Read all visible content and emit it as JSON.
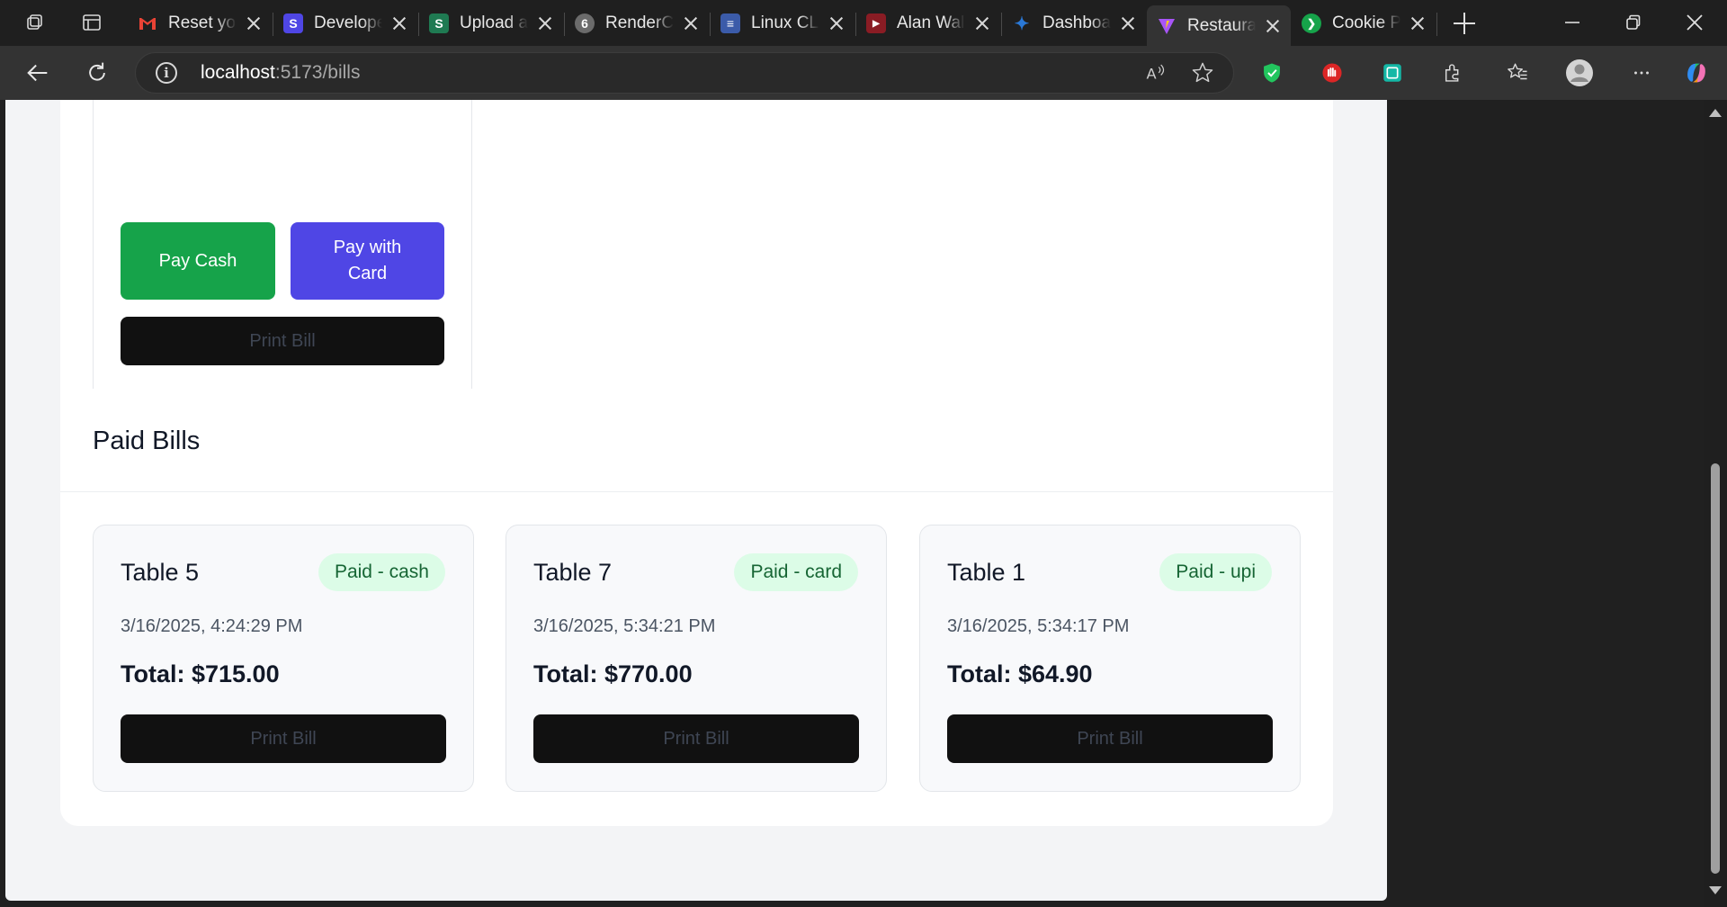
{
  "browser": {
    "tabs": [
      {
        "title": "Reset your password",
        "favicon": "gmail-icon",
        "color": "#ea4335"
      },
      {
        "title": "Developer",
        "favicon": "s-icon",
        "color": "#4f46e5"
      },
      {
        "title": "Upload and",
        "favicon": "s-icon",
        "color": "#1f7a52"
      },
      {
        "title": "RenderCV",
        "favicon": "render-icon",
        "color": "#6b6b6b"
      },
      {
        "title": "Linux CLI",
        "favicon": "doc-icon",
        "color": "#3b5ba9"
      },
      {
        "title": "Alan Walker",
        "favicon": "youtube-icon",
        "color": "#c4302b"
      },
      {
        "title": "Dashboard",
        "favicon": "dashboard-icon",
        "color": "#2a78d6"
      },
      {
        "title": "Restaurant",
        "favicon": "vite-icon",
        "color": "#a855f7",
        "active": true
      },
      {
        "title": "Cookie Pol",
        "favicon": "cookie-icon",
        "color": "#16a34a"
      }
    ],
    "url_host": "localhost",
    "url_rest": ":5173/bills",
    "colors": {
      "accent_cash": "#16a34a",
      "accent_card": "#4f46e5",
      "badge_bg": "#dcfce7",
      "badge_text": "#166534"
    }
  },
  "pending": {
    "pay_cash_label": "Pay Cash",
    "pay_card_label": "Pay with Card",
    "print_label": "Print Bill"
  },
  "paid": {
    "title": "Paid Bills",
    "bills": [
      {
        "table": "Table 5",
        "status": "Paid - cash",
        "date": "3/16/2025, 4:24:29 PM",
        "total": "Total: $715.00",
        "print_label": "Print Bill"
      },
      {
        "table": "Table 7",
        "status": "Paid - card",
        "date": "3/16/2025, 5:34:21 PM",
        "total": "Total: $770.00",
        "print_label": "Print Bill"
      },
      {
        "table": "Table 1",
        "status": "Paid - upi",
        "date": "3/16/2025, 5:34:17 PM",
        "total": "Total: $64.90",
        "print_label": "Print Bill"
      }
    ]
  }
}
